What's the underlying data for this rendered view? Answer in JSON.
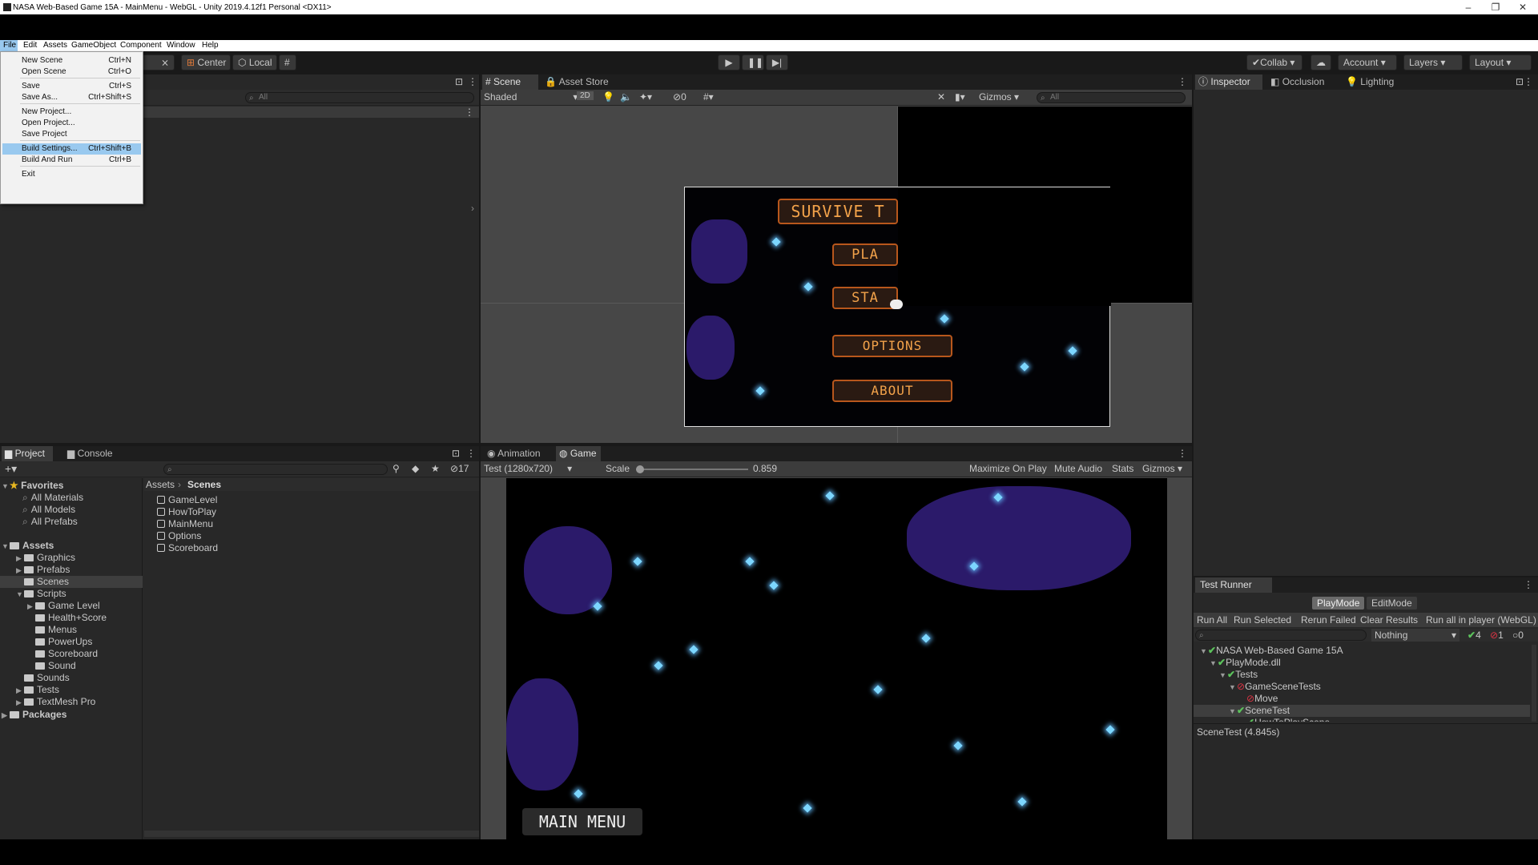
{
  "window": {
    "title": "NASA Web-Based Game 15A - MainMenu - WebGL - Unity 2019.4.12f1 Personal <DX11>",
    "controls": [
      "–",
      "❐",
      "✕"
    ]
  },
  "menubar": [
    "File",
    "Edit",
    "Assets",
    "GameObject",
    "Component",
    "Window",
    "Help"
  ],
  "file_menu": {
    "items": [
      {
        "label": "New Scene",
        "shortcut": "Ctrl+N"
      },
      {
        "label": "Open Scene",
        "shortcut": "Ctrl+O"
      },
      {
        "label": "Save",
        "shortcut": "Ctrl+S"
      },
      {
        "label": "Save As...",
        "shortcut": "Ctrl+Shift+S"
      },
      {
        "label": "New Project...",
        "shortcut": ""
      },
      {
        "label": "Open Project...",
        "shortcut": ""
      },
      {
        "label": "Save Project",
        "shortcut": ""
      },
      {
        "label": "Build Settings...",
        "shortcut": "Ctrl+Shift+B"
      },
      {
        "label": "Build And Run",
        "shortcut": "Ctrl+B"
      },
      {
        "label": "Exit",
        "shortcut": ""
      }
    ],
    "highlighted": "Build Settings..."
  },
  "toolbar": {
    "pivot": "Center",
    "space": "Local",
    "collab": "Collab",
    "account": "Account",
    "layers": "Layers",
    "layout": "Layout"
  },
  "hierarchy": {
    "search_placeholder": "All"
  },
  "scene_view": {
    "tabs": [
      "Scene",
      "Asset Store"
    ],
    "shading": "Shaded",
    "mode_2d": "2D",
    "hidden_count": "0",
    "gizmos": "Gizmos",
    "search_placeholder": "All",
    "buttons": [
      "SURVIVE T",
      "PLA",
      "STA",
      "OPTIONS",
      "ABOUT"
    ]
  },
  "inspector": {
    "tabs": [
      "Inspector",
      "Occlusion",
      "Lighting"
    ]
  },
  "project": {
    "tabs": [
      "Project",
      "Console"
    ],
    "badge": "17",
    "favorites_label": "Favorites",
    "favorites": [
      "All Materials",
      "All Models",
      "All Prefabs"
    ],
    "assets_label": "Assets",
    "tree": [
      {
        "label": "Graphics",
        "depth": 1
      },
      {
        "label": "Prefabs",
        "depth": 1
      },
      {
        "label": "Scenes",
        "depth": 1
      },
      {
        "label": "Scripts",
        "depth": 1
      },
      {
        "label": "Game Level",
        "depth": 2
      },
      {
        "label": "Health+Score",
        "depth": 2
      },
      {
        "label": "Menus",
        "depth": 2
      },
      {
        "label": "PowerUps",
        "depth": 2
      },
      {
        "label": "Scoreboard",
        "depth": 2
      },
      {
        "label": "Sound",
        "depth": 2
      },
      {
        "label": "Sounds",
        "depth": 1
      },
      {
        "label": "Tests",
        "depth": 1
      },
      {
        "label": "TextMesh Pro",
        "depth": 1
      }
    ],
    "packages_label": "Packages",
    "breadcrumb": [
      "Assets",
      "Scenes"
    ],
    "scenes": [
      "GameLevel",
      "HowToPlay",
      "MainMenu",
      "Options",
      "Scoreboard"
    ]
  },
  "game_view": {
    "tabs": [
      "Animation",
      "Game"
    ],
    "resolution": "Test (1280x720)",
    "scale_label": "Scale",
    "scale_value": "0.859",
    "options": [
      "Maximize On Play",
      "Mute Audio",
      "Stats",
      "Gizmos"
    ],
    "overlay_label": "MAIN MENU"
  },
  "test_runner": {
    "title": "Test Runner",
    "modes": [
      "PlayMode",
      "EditMode"
    ],
    "actions": [
      "Run All",
      "Run Selected",
      "Rerun Failed",
      "Clear Results",
      "Run all in player (WebGL)"
    ],
    "filter": "Nothing",
    "counts": {
      "passed": "4",
      "failed": "1",
      "skipped": "0"
    },
    "tree": [
      {
        "label": "NASA Web-Based Game 15A",
        "status": "pass",
        "depth": 0
      },
      {
        "label": "PlayMode.dll",
        "status": "pass",
        "depth": 1
      },
      {
        "label": "Tests",
        "status": "pass",
        "depth": 2
      },
      {
        "label": "GameSceneTests",
        "status": "fail",
        "depth": 3
      },
      {
        "label": "Move",
        "status": "fail",
        "depth": 4
      },
      {
        "label": "SceneTest",
        "status": "pass",
        "depth": 3
      },
      {
        "label": "HowToPlayScene",
        "status": "pass",
        "depth": 4
      }
    ],
    "result": "SceneTest (4.845s)"
  },
  "colors": {
    "accent_blue": "#3d6fb5",
    "menu_highlight": "#99c9ef",
    "orange": "#f2a24a",
    "pass": "#5cc35c",
    "fail": "#d33344"
  }
}
